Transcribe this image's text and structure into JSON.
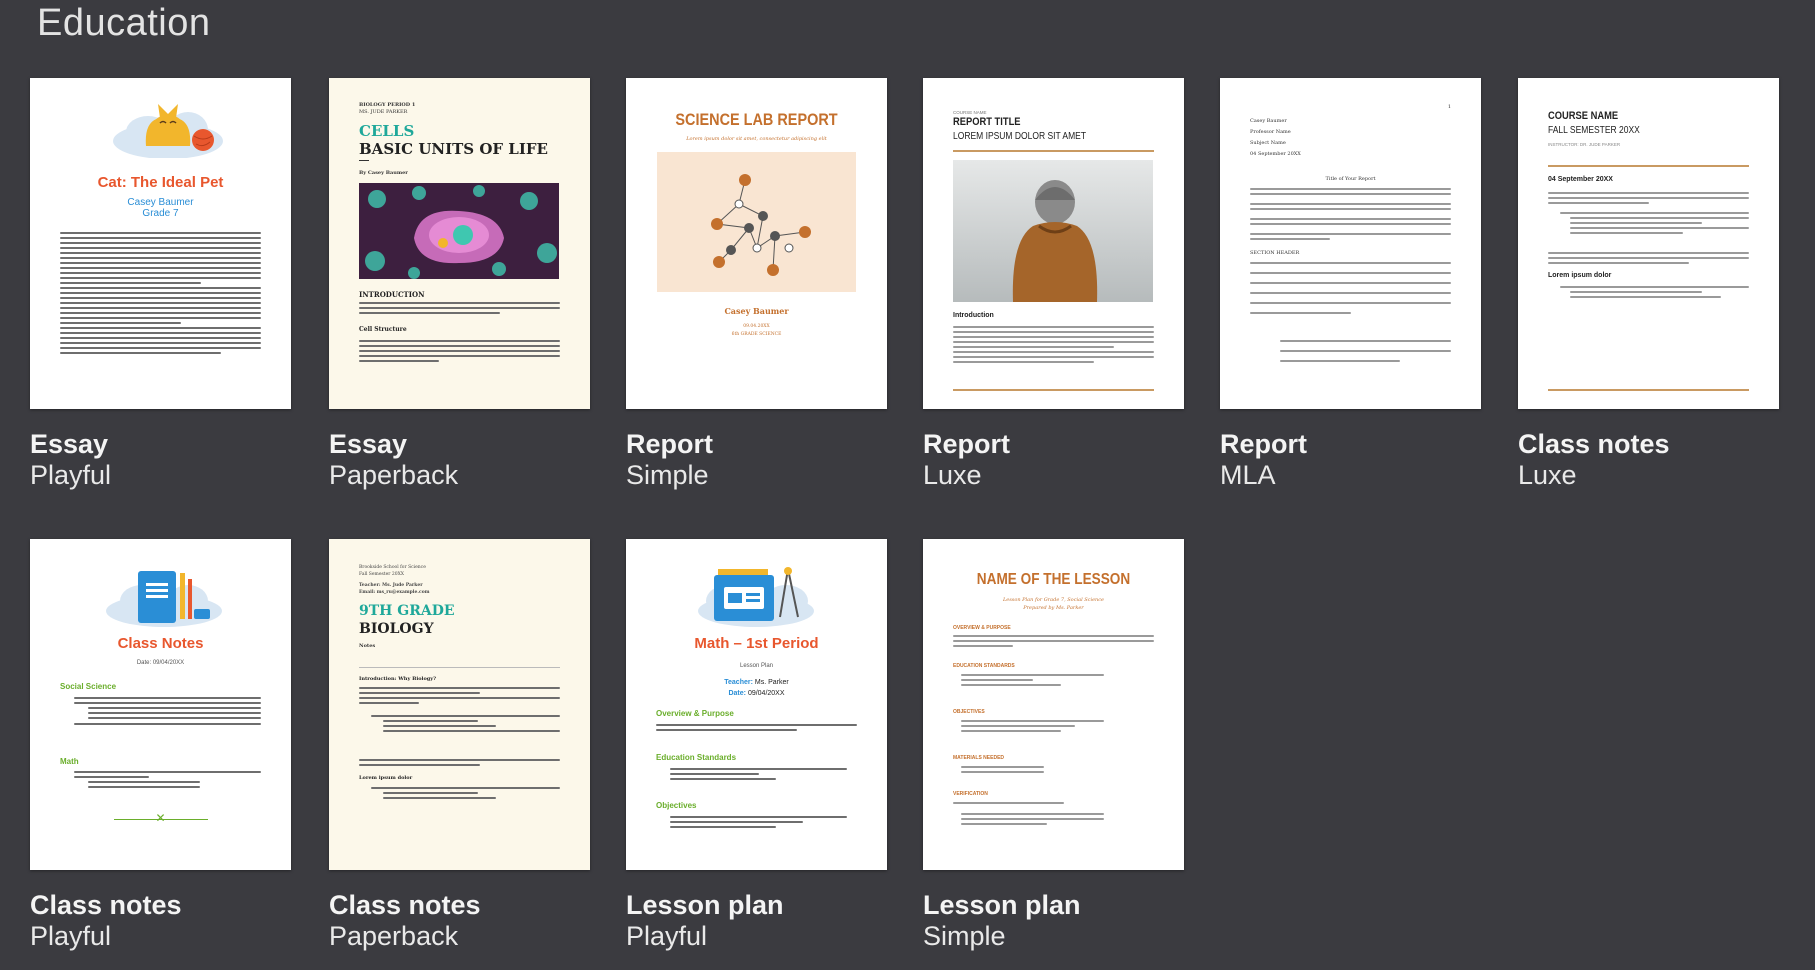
{
  "section": {
    "title": "Education"
  },
  "templates": [
    {
      "name": "Essay",
      "style": "Playful",
      "preview": {
        "title": "Cat: The Ideal Pet",
        "author": "Casey Baumer",
        "grade": "Grade 7"
      }
    },
    {
      "name": "Essay",
      "style": "Paperback",
      "preview": {
        "header1": "BIOLOGY PERIOD 1",
        "header2": "MS. JUDE PARKER",
        "title_line1": "CELLS",
        "title_line2": "BASIC UNITS OF LIFE",
        "byline": "By Casey Baumer",
        "heading": "INTRODUCTION",
        "subheading": "Cell Structure"
      }
    },
    {
      "name": "Report",
      "style": "Simple",
      "preview": {
        "title": "SCIENCE LAB REPORT",
        "subtitle": "Lorem ipsum dolor sit amet, consectetur adipiscing elit",
        "author": "Casey Baumer",
        "date": "09.04.20XX",
        "grade": "6th GRADE SCIENCE"
      }
    },
    {
      "name": "Report",
      "style": "Luxe",
      "preview": {
        "kicker": "COURSE NAME",
        "title": "REPORT TITLE",
        "subtitle": "LOREM IPSUM DOLOR SIT AMET",
        "heading": "Introduction"
      }
    },
    {
      "name": "Report",
      "style": "MLA",
      "preview": {
        "page_number": "1",
        "line1": "Casey Baumer",
        "line2": "Professor Name",
        "line3": "Subject Name",
        "line4": "04 September 20XX",
        "title": "Title of Your Report",
        "heading": "SECTION HEADER"
      }
    },
    {
      "name": "Class notes",
      "style": "Luxe",
      "preview": {
        "title": "COURSE NAME",
        "subtitle": "FALL SEMESTER 20XX",
        "instructor": "INSTRUCTOR: DR. JUDE PARKER",
        "date": "04 September 20XX",
        "heading": "Lorem ipsum dolor"
      }
    },
    {
      "name": "Class notes",
      "style": "Playful",
      "preview": {
        "title": "Class Notes",
        "date": "Date: 09/04/20XX",
        "heading1": "Social Science",
        "heading2": "Math"
      }
    },
    {
      "name": "Class notes",
      "style": "Paperback",
      "preview": {
        "school": "Brookside School for Science",
        "term": "Fall Semester 20XX",
        "teacher": "Teacher: Ms. Jude Parker",
        "email": "Email: ms_ru@example.com",
        "title_line1": "9TH GRADE",
        "title_line2": "BIOLOGY",
        "notes": "Notes",
        "heading": "Introduction: Why Biology?",
        "subheading": "Lorem ipsum dolor"
      }
    },
    {
      "name": "Lesson plan",
      "style": "Playful",
      "preview": {
        "title": "Math – 1st Period",
        "subtitle": "Lesson Plan",
        "teacher_label": "Teacher:",
        "teacher": "Ms. Parker",
        "date_label": "Date:",
        "date": "09/04/20XX",
        "heading1": "Overview & Purpose",
        "heading2": "Education Standards",
        "heading3": "Objectives"
      }
    },
    {
      "name": "Lesson plan",
      "style": "Simple",
      "preview": {
        "title": "NAME OF THE LESSON",
        "subtitle": "Lesson Plan for Grade 7, Social Science",
        "prepared": "Prepared by Ms. Parker",
        "heading1": "OVERVIEW & PURPOSE",
        "heading2": "EDUCATION STANDARDS",
        "heading3": "OBJECTIVES",
        "heading4": "MATERIALS NEEDED",
        "heading5": "VERIFICATION"
      }
    }
  ],
  "colors": {
    "background": "#3b3b40",
    "orange": "#e8572e",
    "teal": "#1fa89a",
    "gold": "#c99a62",
    "blue": "#2a8ed6",
    "green": "#6aae2b"
  }
}
